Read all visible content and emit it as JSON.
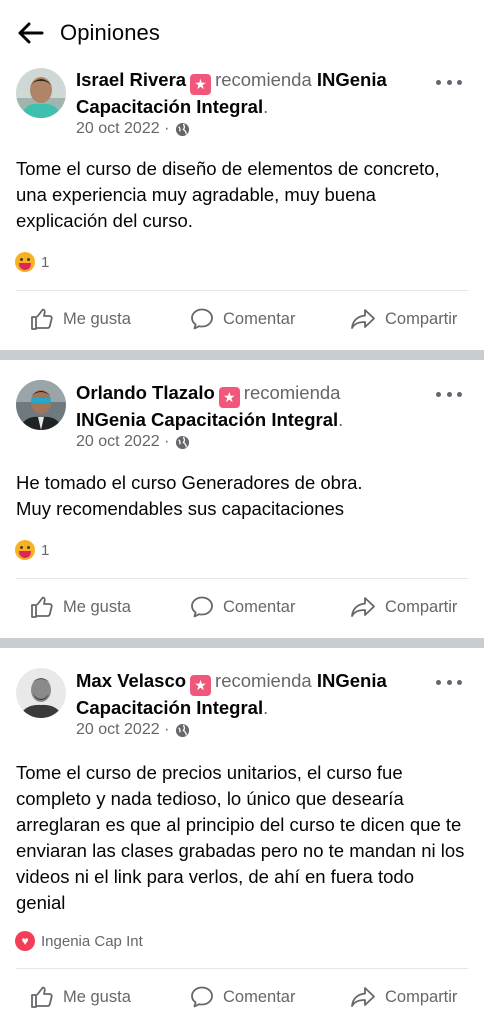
{
  "header": {
    "title": "Opiniones"
  },
  "posts": [
    {
      "author": "Israel Rivera",
      "verb": "recomienda",
      "page": "INGenia Capacitación Integral",
      "date": "20 oct 2022 ·",
      "body": "Tome el curso de diseño de elementos de concreto, una experiencia muy agradable, muy buena explicación del curso.",
      "reaction_count": "1"
    },
    {
      "author": "Orlando Tlazalo",
      "verb": "recomienda",
      "page": "INGenia Capacitación Integral",
      "date": "20 oct 2022 ·",
      "body_lines": [
        "He tomado el curso Generadores de obra.",
        "Muy recomendables sus capacitaciones"
      ],
      "reaction_count": "1"
    },
    {
      "author": "Max Velasco",
      "verb": "recomienda",
      "page": "INGenia Capacitación Integral",
      "date": "20 oct 2022 ·",
      "body": "Tome el curso de precios unitarios, el curso fue completo y nada tedioso, lo único que desearía arreglaran es que al principio del curso te dicen que te enviaran las clases grabadas pero no te mandan ni los videos ni el link para verlos, de ahí en fuera todo genial",
      "reacted_by": "Ingenia Cap Int"
    }
  ],
  "actions": {
    "like": "Me gusta",
    "comment": "Comentar",
    "share": "Compartir"
  },
  "colors": {
    "text": "#050505",
    "secondary": "#65676b",
    "badge": "#f0577a",
    "separator": "#c9ccd1"
  }
}
